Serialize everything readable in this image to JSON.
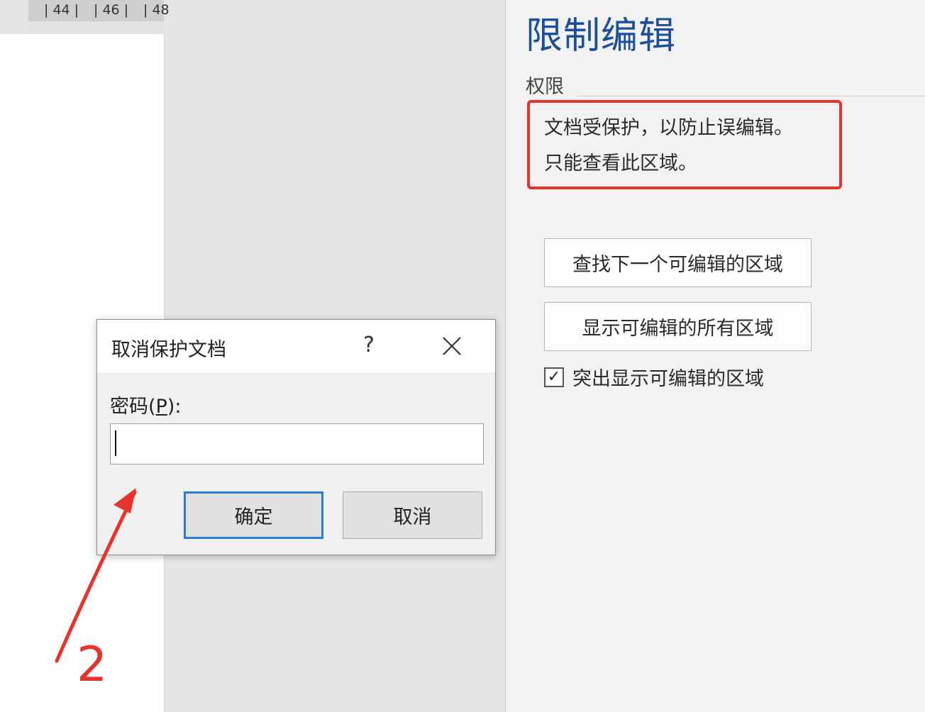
{
  "ruler": {
    "labels": [
      "| 44 |",
      "| 46 |",
      "| 48"
    ]
  },
  "panel": {
    "title": "限制编辑",
    "section_label": "权限",
    "info_lines": [
      "文档受保护，以防止误编辑。",
      "只能查看此区域。"
    ],
    "buttons": [
      "查找下一个可编辑的区域",
      "显示可编辑的所有区域"
    ],
    "checkbox": {
      "label": "突出显示可编辑的区域",
      "checked": true,
      "check_mark": "✓"
    }
  },
  "dialog": {
    "title": "取消保护文档",
    "help": "?",
    "password_label_prefix": "密码(",
    "password_label_key": "P",
    "password_label_suffix": "):",
    "password_value": "",
    "ok_label": "确定",
    "cancel_label": "取消"
  },
  "annotation": {
    "number": "2",
    "color": "#e8322d"
  },
  "colors": {
    "title_blue": "#1d4e9a",
    "highlight_red": "#e8322d",
    "focus_blue": "#2b7cd3"
  },
  "icons": {
    "close": "close-icon",
    "check": "checkmark-icon"
  }
}
